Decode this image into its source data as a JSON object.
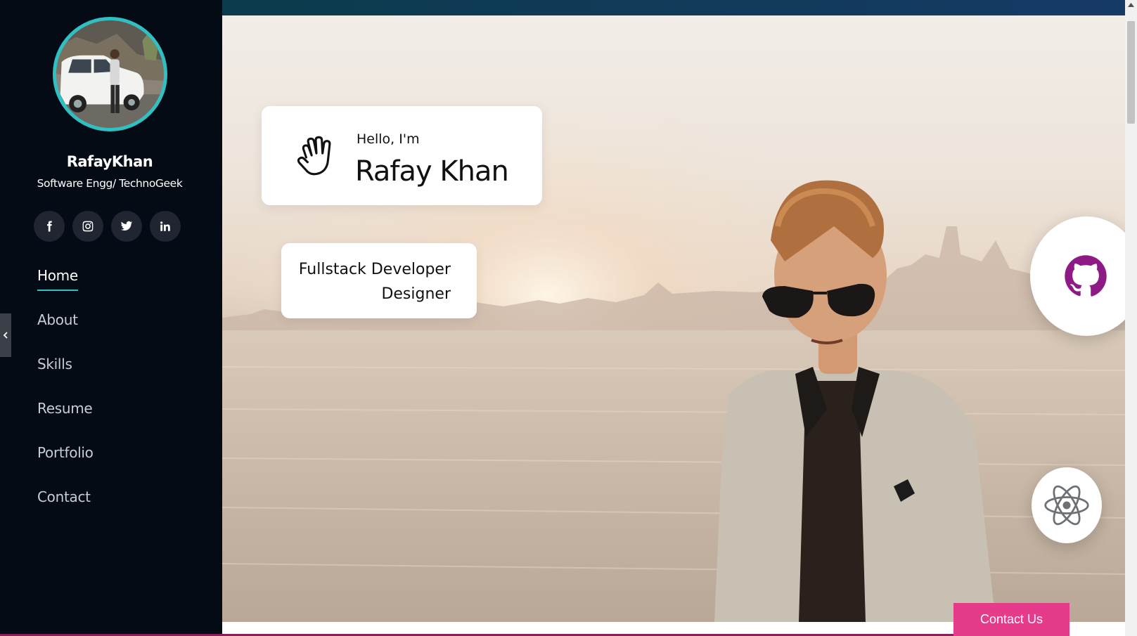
{
  "profile": {
    "name": "RafayKhan",
    "tagline": "Software Engg/ TechnoGeek"
  },
  "social": [
    {
      "icon": "facebook-icon"
    },
    {
      "icon": "instagram-icon"
    },
    {
      "icon": "twitter-icon"
    },
    {
      "icon": "linkedin-icon"
    }
  ],
  "nav": {
    "items": [
      {
        "label": "Home",
        "active": true
      },
      {
        "label": "About"
      },
      {
        "label": "Skills"
      },
      {
        "label": "Resume"
      },
      {
        "label": "Portfolio"
      },
      {
        "label": "Contact"
      }
    ]
  },
  "hero": {
    "greeting": "Hello, I'm",
    "name": "Rafay Khan",
    "roles": [
      "Fullstack Developer",
      "Designer"
    ]
  },
  "floating_icons": [
    "database-icon",
    "github-icon",
    "react-icon"
  ],
  "contact_button": "Contact Us",
  "colors": {
    "sidebar_bg": "#040b14",
    "accent": "#2fc0c4",
    "contact_button": "#e63a8b",
    "github_purple": "#8e1a86"
  }
}
